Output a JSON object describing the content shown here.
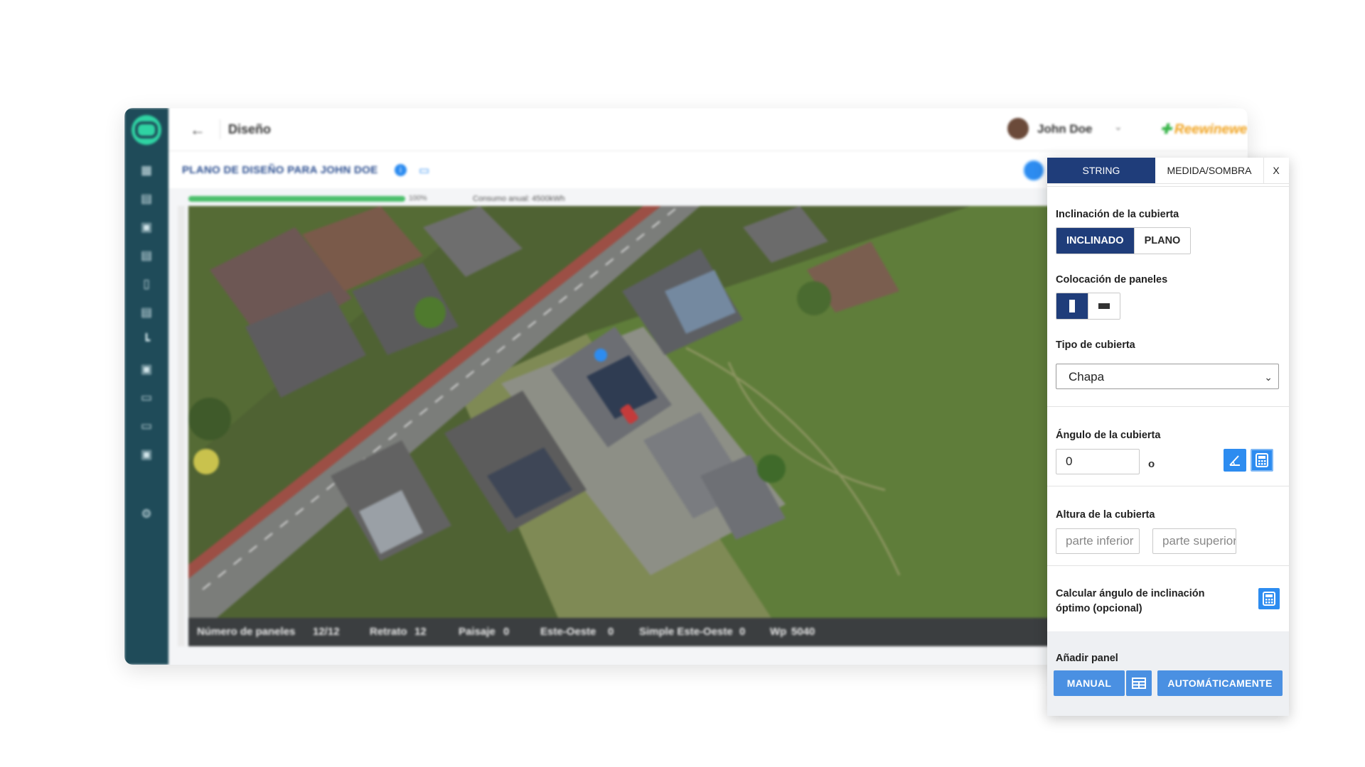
{
  "app": {
    "window_title": "Diseño",
    "user_name": "John Doe",
    "brand": "Reewinewe",
    "plan_title": "PLANO DE DISEÑO PARA JOHN DOE",
    "progress_pct_label": "100%",
    "progress_value": 1.0,
    "consumo": "Consumo anual: 4500kWh"
  },
  "sidebar": {
    "icons": [
      "dashboard-icon",
      "calendar-icon",
      "calendar-check-icon",
      "calendar-edit-icon",
      "clipboard-icon",
      "document-icon",
      "chart-icon",
      "camera-icon",
      "message-icon",
      "video-icon",
      "contact-card-icon"
    ],
    "settings_icon": "gear-icon"
  },
  "statusbar": {
    "paneles_label": "Número de paneles",
    "paneles_value": "12/12",
    "retrato_label": "Retrato",
    "retrato_value": "12",
    "paisaje_label": "Paisaje",
    "paisaje_value": "0",
    "este_oeste_label": "Este-Oeste",
    "este_oeste_value": "0",
    "simple_label": "Simple Este-Oeste",
    "simple_value": "0",
    "wp_label": "Wp",
    "wp_value": "5040"
  },
  "panel": {
    "tabs": [
      "STRING",
      "MEDIDA/SOMBRA",
      "X"
    ],
    "inclinacion_label": "Inclinación de la cubierta",
    "inclinacion_options": [
      "INCLINADO",
      "PLANO"
    ],
    "colocacion_label": "Colocación de paneles",
    "tipo_label": "Tipo de cubierta",
    "tipo_value": "Chapa",
    "angulo_label": "Ángulo de la cubierta",
    "angulo_value": "0",
    "angulo_unit": "o",
    "altura_label": "Altura de la cubierta",
    "altura_inferior_placeholder": "parte inferior",
    "altura_superior_placeholder": "parte superior",
    "calcular_label": "Calcular ángulo de inclinación óptimo (opcional)",
    "anadir_label": "Añadir panel",
    "manual_label": "MANUAL",
    "auto_label": "AUTOMÁTICAMENTE"
  },
  "colors": {
    "sidebar": "#1f4b59",
    "primary_dark": "#1f3d7a",
    "primary_blue": "#4a90e2",
    "accent_blue": "#2d8cf0",
    "progress_green": "#4bbf6b"
  }
}
